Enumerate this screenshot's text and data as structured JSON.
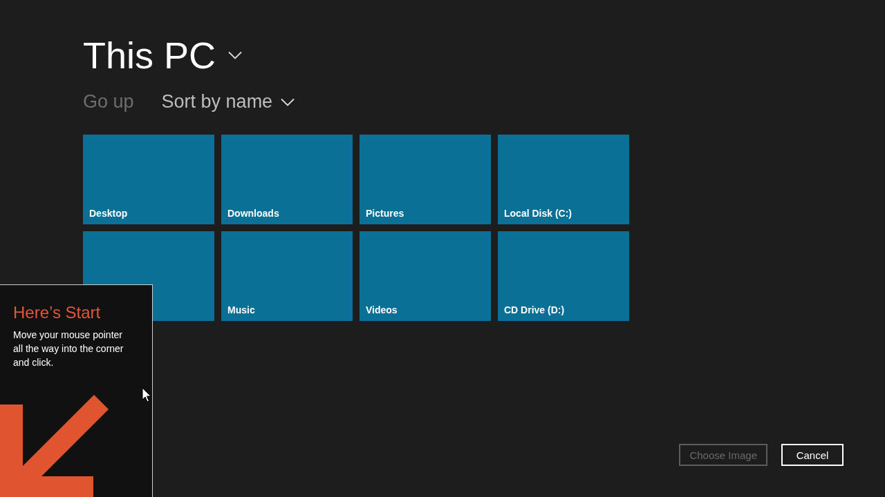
{
  "header": {
    "title": "This PC"
  },
  "commands": [
    {
      "label": "Go up",
      "disabled": true,
      "kind": "button"
    },
    {
      "label": "Sort by name",
      "disabled": false,
      "kind": "dropdown"
    }
  ],
  "tiles": [
    {
      "kind": "tile",
      "label": "Desktop"
    },
    {
      "kind": "tile",
      "label": "Downloads"
    },
    {
      "kind": "tile",
      "label": "Pictures"
    },
    {
      "kind": "tile",
      "label": "Local Disk (C:)"
    },
    {
      "kind": "tile"
    },
    {
      "kind": "tile",
      "label": "Music"
    },
    {
      "kind": "tile",
      "label": "Videos"
    },
    {
      "kind": "tile",
      "label": "CD Drive (D:)"
    }
  ],
  "tip": {
    "title": "Here’s Start",
    "text": "Move your mouse pointer all the way into the corner and click."
  },
  "buttons": [
    {
      "label": "Choose Image",
      "disabled": true
    },
    {
      "label": "Cancel",
      "disabled": false
    }
  ]
}
